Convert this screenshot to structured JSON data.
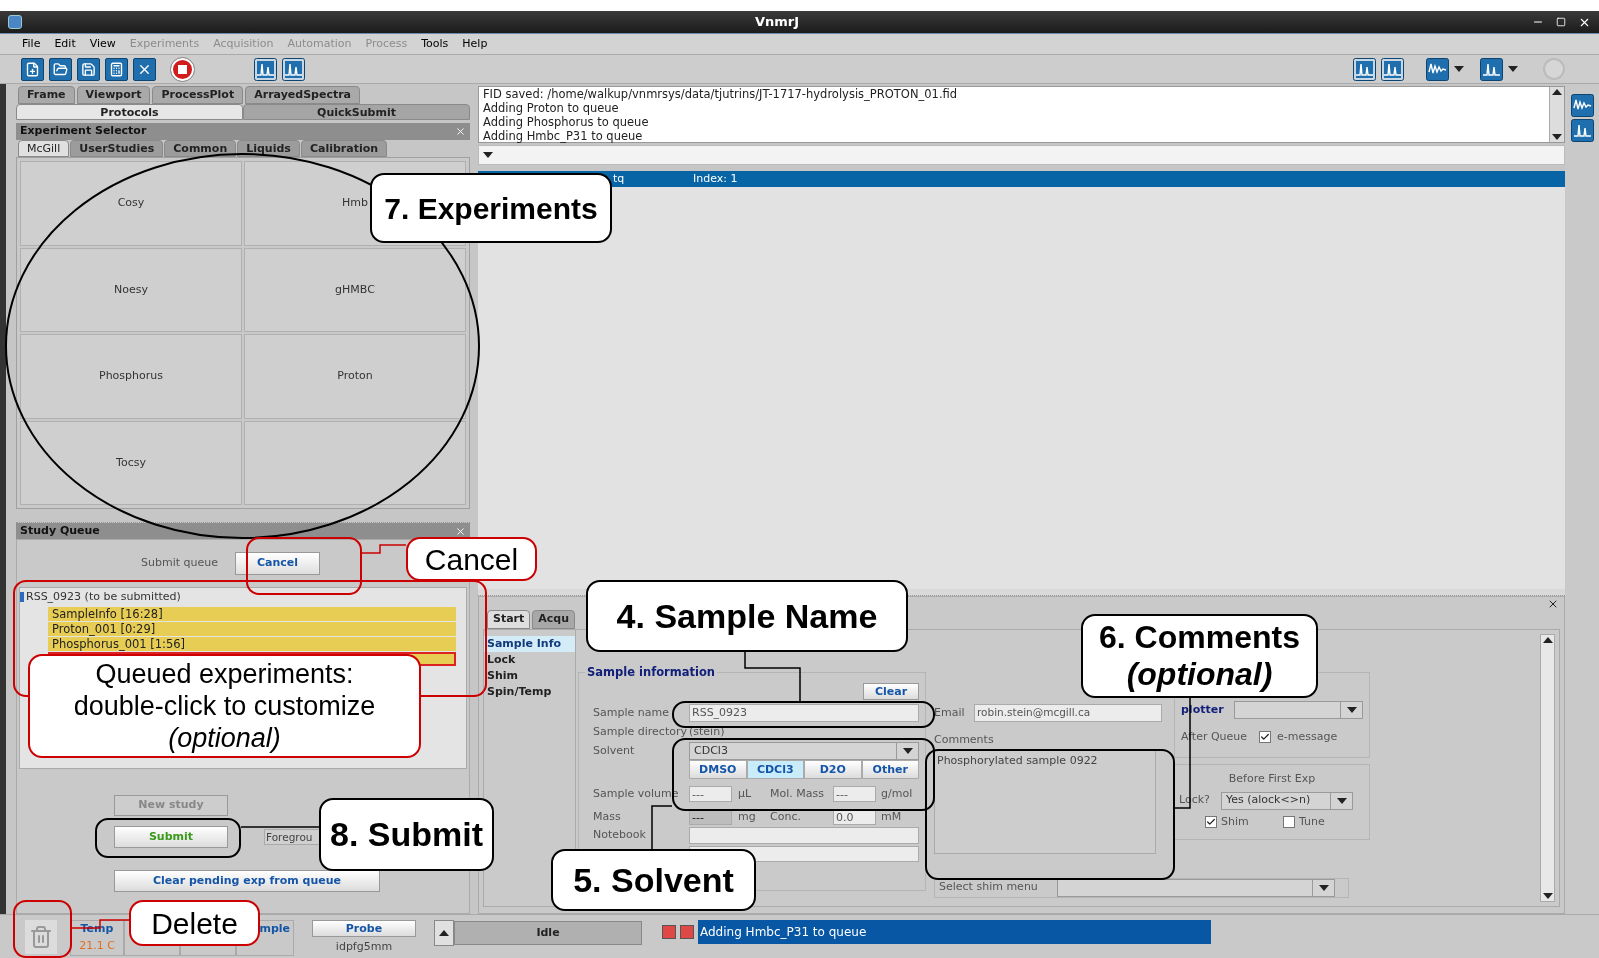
{
  "window": {
    "title": "VnmrJ"
  },
  "menu": [
    {
      "label": "File",
      "disabled": false
    },
    {
      "label": "Edit",
      "disabled": false
    },
    {
      "label": "View",
      "disabled": false
    },
    {
      "label": "Experiments",
      "disabled": true
    },
    {
      "label": "Acquisition",
      "disabled": true
    },
    {
      "label": "Automation",
      "disabled": true
    },
    {
      "label": "Process",
      "disabled": true
    },
    {
      "label": "Tools",
      "disabled": false
    },
    {
      "label": "Help",
      "disabled": false
    }
  ],
  "view_tabs": [
    [
      {
        "label": "Frame",
        "selected": false
      },
      {
        "label": "Viewport",
        "selected": false
      },
      {
        "label": "ProcessPlot",
        "selected": false
      },
      {
        "label": "ArrayedSpectra",
        "selected": false
      }
    ],
    [
      {
        "label": "Protocols",
        "selected": true
      },
      {
        "label": "QuickSubmit",
        "selected": false
      }
    ]
  ],
  "experiment_selector": {
    "title": "Experiment Selector",
    "tabs": [
      {
        "label": "McGill",
        "selected": true
      },
      {
        "label": "UserStudies",
        "selected": false
      },
      {
        "label": "Common",
        "selected": false
      },
      {
        "label": "Liquids",
        "selected": false
      },
      {
        "label": "Calibration",
        "selected": false
      }
    ],
    "experiments": [
      "Cosy",
      "Hmb",
      "Noesy",
      "gHMBC",
      "Phosphorus",
      "Proton",
      "Tocsy"
    ]
  },
  "study_queue": {
    "title": "Study Queue",
    "submit_label": "Submit queue",
    "cancel_button": "Cancel",
    "tree": {
      "label": "RSS_0923 (to be submitted)",
      "expanded": true,
      "children": [
        {
          "label": "SampleInfo [16:28]",
          "selected": false
        },
        {
          "label": "Proton_001 [0:29]",
          "selected": false
        },
        {
          "label": "Phosphorus_001 [1:56]",
          "selected": false
        },
        {
          "selected": true
        }
      ]
    },
    "new_study_button": "New study",
    "submit_button": "Submit",
    "mode_field": "Foregrou",
    "clear_button": "Clear pending exp from queue"
  },
  "messages": [
    "FID saved: /home/walkup/vnmrsys/data/tjutrins/JT-1717-hydrolysis_PROTON_01.fid",
    "Adding Proton to queue",
    "Adding Phosphorus to queue",
    "Adding Hmbc_P31 to queue"
  ],
  "history_row": {
    "column_1": "tq",
    "column_2": "Index: 1"
  },
  "parameter_panel": {
    "tabs": [
      {
        "label": "Start",
        "selected": true
      },
      {
        "label": "Acqu",
        "selected": false
      }
    ],
    "pages": [
      {
        "label": "Sample Info",
        "selected": true
      },
      {
        "label": "Lock",
        "selected": false
      },
      {
        "label": "Shim",
        "selected": false
      },
      {
        "label": "Spin/Temp",
        "selected": false
      }
    ],
    "sample_information": {
      "title": "Sample information",
      "clear_button": "Clear",
      "sample_name": {
        "label": "Sample name",
        "value": "RSS_0923"
      },
      "sample_directory": {
        "label": "Sample directory",
        "value": "(stein)"
      },
      "solvent": {
        "label": "Solvent",
        "value": "CDCl3",
        "options": [
          {
            "label": "DMSO",
            "selected": false
          },
          {
            "label": "CDCl3",
            "selected": true
          },
          {
            "label": "D2O",
            "selected": false
          },
          {
            "label": "Other",
            "selected": false
          }
        ]
      },
      "sample_volume": {
        "label": "Sample volume",
        "value": "---",
        "unit": "µL"
      },
      "mol_mass": {
        "label": "Mol. Mass",
        "value": "---",
        "unit": "g/mol"
      },
      "mass": {
        "label": "Mass",
        "value": "---",
        "unit": "mg",
        "disabled": true
      },
      "conc": {
        "label": "Conc.",
        "value": "0.0",
        "unit": "mM"
      },
      "notebook": {
        "label": "Notebook"
      }
    },
    "email": {
      "label": "Email",
      "value": "robin.stein@mcgill.ca"
    },
    "comments": {
      "label": "Comments",
      "value": "Phosphorylated sample 0922"
    },
    "after_queue": {
      "plotter_label": "plotter",
      "label": "After Queue",
      "emessage": {
        "label": "e-message",
        "checked": true
      }
    },
    "before_first_exp": {
      "title": "Before First Exp",
      "lock_label": "Lock?",
      "lock_value": "Yes (alock<>n)",
      "shim": {
        "label": "Shim",
        "checked": true
      },
      "tune": {
        "label": "Tune",
        "checked": false
      }
    },
    "shim_menu": {
      "label": "Select shim menu"
    }
  },
  "status_bar": {
    "temp_label": "Temp",
    "temp_value": "21.1 C",
    "sample_label": "mple",
    "probe_button": "Probe",
    "probe_value": "idpfg5mm",
    "state": "Idle",
    "message": "Adding Hmbc_P31 to queue"
  },
  "annotations": [
    {
      "kind": "step",
      "text": "7. Experiments"
    },
    {
      "kind": "note",
      "text": "Cancel"
    },
    {
      "kind": "note",
      "text": "Queued experiments:\ndouble-click to customize\n*(optional)*"
    },
    {
      "kind": "step",
      "text": "4. Sample Name"
    },
    {
      "kind": "step",
      "text": "5. Solvent"
    },
    {
      "kind": "step",
      "text": "6. Comments\n*(optional)*"
    },
    {
      "kind": "step",
      "text": "8. Submit"
    },
    {
      "kind": "note",
      "text": "Delete"
    }
  ]
}
